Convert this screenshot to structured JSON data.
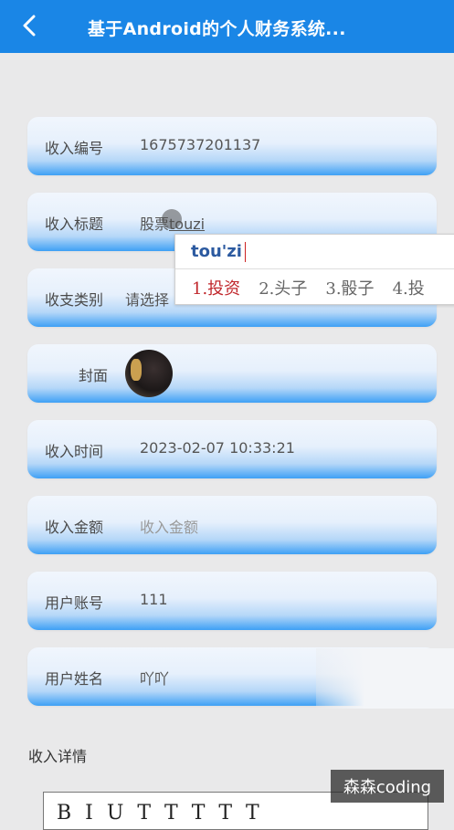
{
  "header": {
    "title": "基于Android的个人财务系统..."
  },
  "form": {
    "rows": [
      {
        "label": "收入编号",
        "value": "1675737201137"
      },
      {
        "label": "收入标题",
        "value_prefix": "股票",
        "value_typed": "touzi"
      },
      {
        "label": "收支类别",
        "value": "请选择"
      },
      {
        "label": "封面"
      },
      {
        "label": "收入时间",
        "value": "2023-02-07 10:33:21"
      },
      {
        "label": "收入金额",
        "placeholder": "收入金额"
      },
      {
        "label": "用户账号",
        "value": "111"
      },
      {
        "label": "用户姓名",
        "value": "吖吖"
      }
    ],
    "details_label": "收入详情"
  },
  "ime": {
    "pinyin": "tou'zi",
    "candidates": [
      "1.投资",
      "2.头子",
      "3.骰子",
      "4.投"
    ]
  },
  "editor": {
    "toolbar_glyphs": "B I U T T T T T"
  },
  "watermark": "森森coding"
}
